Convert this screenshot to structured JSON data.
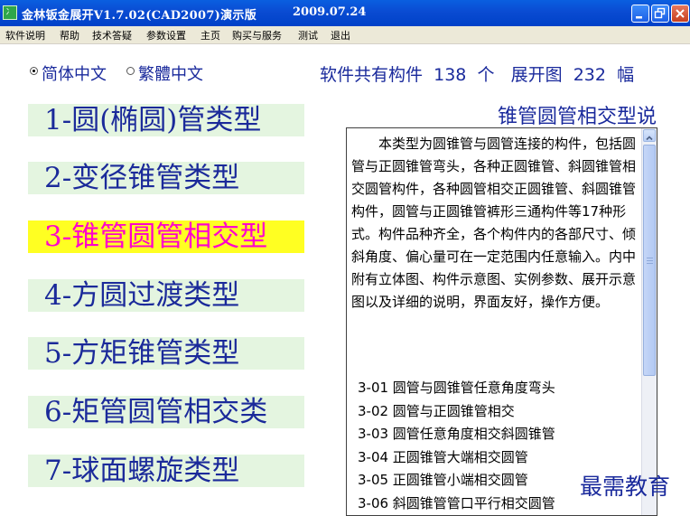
{
  "window": {
    "title": "金林钣金展开V1.7.02(CAD2007)演示版",
    "date": "2009.07.24",
    "icon_glyph": "冫"
  },
  "menu": [
    "软件说明",
    "帮助",
    "技术答疑",
    "参数设置",
    "主页",
    "购买与服务",
    "测试",
    "退出"
  ],
  "language": {
    "simplified": "简体中文",
    "traditional": "繁體中文",
    "selected": "simplified"
  },
  "stats": {
    "prefix": "软件共有构件",
    "parts": "138",
    "unit1": "个",
    "middle": "展开图",
    "drawings": "232",
    "unit2": "幅"
  },
  "types": [
    {
      "label": "1-圆(椭圆)管类型",
      "active": false
    },
    {
      "label": "2-变径锥管类型",
      "active": false
    },
    {
      "label": "3-锥管圆管相交型",
      "active": true
    },
    {
      "label": "4-方圆过渡类型",
      "active": false
    },
    {
      "label": "5-方矩锥管类型",
      "active": false
    },
    {
      "label": "6-矩管圆管相交类",
      "active": false
    },
    {
      "label": "7-球面螺旋类型",
      "active": false
    }
  ],
  "description": {
    "title": "锥管圆管相交型说",
    "text": "本类型为圆锥管与圆管连接的构件，包括圆管与正圆锥管弯头，各种正圆锥管、斜圆锥管相交圆管构件，各种圆管相交正圆锥管、斜圆锥管构件，圆管与正圆锥管裤形三通构件等17种形式。构件品种齐全，各个构件内的各部尺寸、倾斜角度、偏心量可在一定范围内任意输入。内中附有立体图、构件示意图、实例参数、展开示意图以及详细的说明，界面友好，操作方便。",
    "items": [
      "3-01  圆管与圆锥管任意角度弯头",
      "3-02  圆管与正圆锥管相交",
      "3-03  圆管任意角度相交斜圆锥管",
      "3-04  正圆锥管大端相交圆管",
      "3-05  正圆锥管小端相交圆管",
      "3-06  斜圆锥管管口平行相交圆管"
    ]
  },
  "watermark": "最需教育",
  "colors": {
    "titlebar": "#0a4bd2",
    "type_bg": "#e4f5e0",
    "type_text": "#1b2a9a",
    "active_bg": "#ffff22",
    "active_text": "#ff00cc",
    "label_text": "#1a2a9c"
  }
}
